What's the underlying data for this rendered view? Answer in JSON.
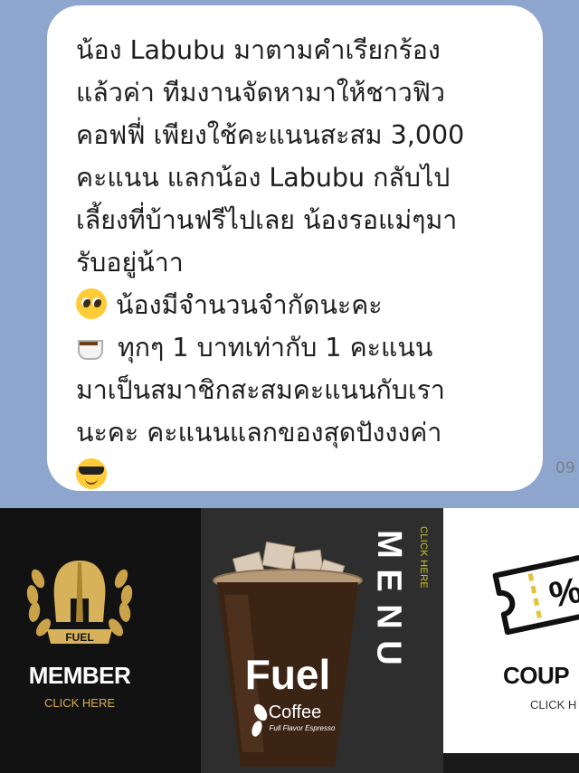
{
  "chat": {
    "message_lines": [
      "น้อง Labubu มาตามคำเรียกร้อง",
      "แล้วค่า  ทีมงานจัดหามาให้ชาวฟิว",
      "คอฟฟี่ เพียงใช้คะแนนสะสม 3,000",
      "คะแนน แลกน้อง Labubu กลับไป",
      "เลี้ยงที่บ้านฟรีไปเลย น้องรอแม่ๆมา",
      "รับอยู่น้าา",
      "น้องมีจำนวนจำกัดนะคะ",
      "ทุกๆ 1 บาทเท่ากับ 1 คะแนน",
      "มาเป็นสมาชิกสะสมคะแนนกับเรา",
      "นะคะ  คะแนนแลกของสุดปังงงค่า"
    ],
    "emojis": {
      "line7": "pleading-face-icon",
      "line8": "hot-beverage-icon",
      "closing": "smiling-face-with-sunglasses-icon"
    },
    "timestamp": "09"
  },
  "menu_strip": {
    "member": {
      "badge_text": "FUEL",
      "title": "MEMBER",
      "subtitle": "CLICK HERE"
    },
    "menu": {
      "cup_brand": "Fuel",
      "cup_product": "Coffee",
      "cup_tagline": "Full Flavor Espresso",
      "title_letters": [
        "M",
        "E",
        "N",
        "U"
      ],
      "subtitle": "CLICK HERE"
    },
    "coupon": {
      "title": "COUP",
      "subtitle": "CLICK H"
    }
  },
  "colors": {
    "chat_background": "#8ea6cd",
    "bubble": "#ffffff",
    "member_gold": "#d6ae52",
    "menu_click_yellow": "#c7c428"
  }
}
